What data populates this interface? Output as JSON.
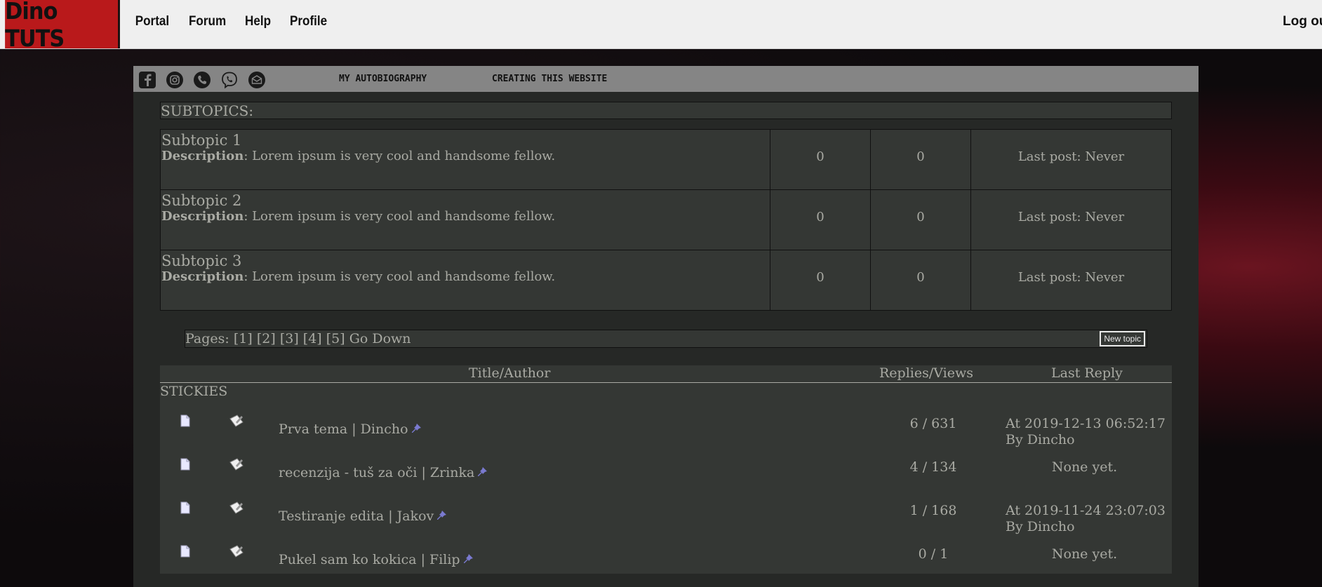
{
  "header": {
    "logo": "Dino TUTS",
    "nav": [
      "Portal",
      "Forum",
      "Help",
      "Profile"
    ],
    "logout": "Log out"
  },
  "subbar": {
    "social_icons": [
      "facebook-icon",
      "instagram-icon",
      "phone-icon",
      "viber-icon",
      "mail-icon"
    ],
    "links": [
      "MY AUTOBIOGRAPHY",
      "CREATING THIS WEBSITE"
    ]
  },
  "subtopics": {
    "heading": "SUBTOPICS:",
    "desc_label": "Description",
    "items": [
      {
        "title": "Subtopic 1",
        "desc": ": Lorem ipsum is very cool and handsome fellow.",
        "a": "0",
        "b": "0",
        "last": "Last post: Never"
      },
      {
        "title": "Subtopic 2",
        "desc": ": Lorem ipsum is very cool and handsome fellow.",
        "a": "0",
        "b": "0",
        "last": "Last post: Never"
      },
      {
        "title": "Subtopic 3",
        "desc": ": Lorem ipsum is very cool and handsome fellow.",
        "a": "0",
        "b": "0",
        "last": "Last post: Never"
      }
    ]
  },
  "pagination": {
    "label": "Pages:",
    "pages": [
      "[1]",
      "[2]",
      "[3]",
      "[4]",
      "[5]"
    ],
    "go_down": "Go Down",
    "new_topic": "New topic"
  },
  "topics": {
    "col_title": "Title/Author",
    "col_replies": "Replies/Views",
    "col_last": "Last Reply",
    "section": "STICKIES",
    "rows": [
      {
        "title": "Prva tema | Dincho",
        "rv": "6 / 631",
        "last": "At 2019-12-13 06:52:17 By Dincho"
      },
      {
        "title": "recenzija - tuš za oči | Zrinka",
        "rv": "4 / 134",
        "last": "None yet."
      },
      {
        "title": "Testiranje edita | Jakov",
        "rv": "1 / 168",
        "last": "At 2019-11-24 23:07:03 By Dincho"
      },
      {
        "title": "Pukel sam ko kokica | Filip",
        "rv": "0 / 1",
        "last": "None yet."
      }
    ]
  }
}
